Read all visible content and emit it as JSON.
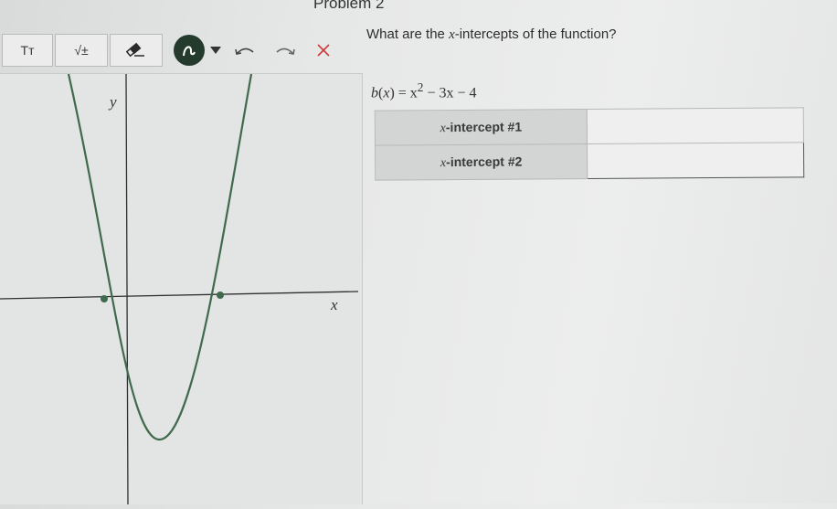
{
  "problem": {
    "title": "Problem 2"
  },
  "toolbar": {
    "text_button": "Tт",
    "math_button": "√±",
    "eraser_icon": "eraser-icon",
    "draw_icon": "curve-draw-icon",
    "dropdown_icon": "triangle-down-icon",
    "undo_icon": "undo-icon",
    "redo_icon": "redo-icon",
    "clear_icon": "close-icon"
  },
  "graph": {
    "x_label": "x",
    "y_label": "y",
    "curve_color": "#3f6a4b",
    "function": "x^2 - 3x - 4",
    "intercepts_marked": [
      -1,
      4
    ]
  },
  "question": {
    "text_pre": "What are the",
    "var": "x",
    "text_post": "-intercepts of the function?"
  },
  "function_display": {
    "name": "b",
    "var": "x",
    "rhs_pre": "= x",
    "exp": "2",
    "rhs_post": " − 3x − 4"
  },
  "answers": [
    {
      "label_var": "x",
      "label_text": "-intercept #1",
      "value": ""
    },
    {
      "label_var": "x",
      "label_text": "-intercept #2",
      "value": ""
    }
  ]
}
